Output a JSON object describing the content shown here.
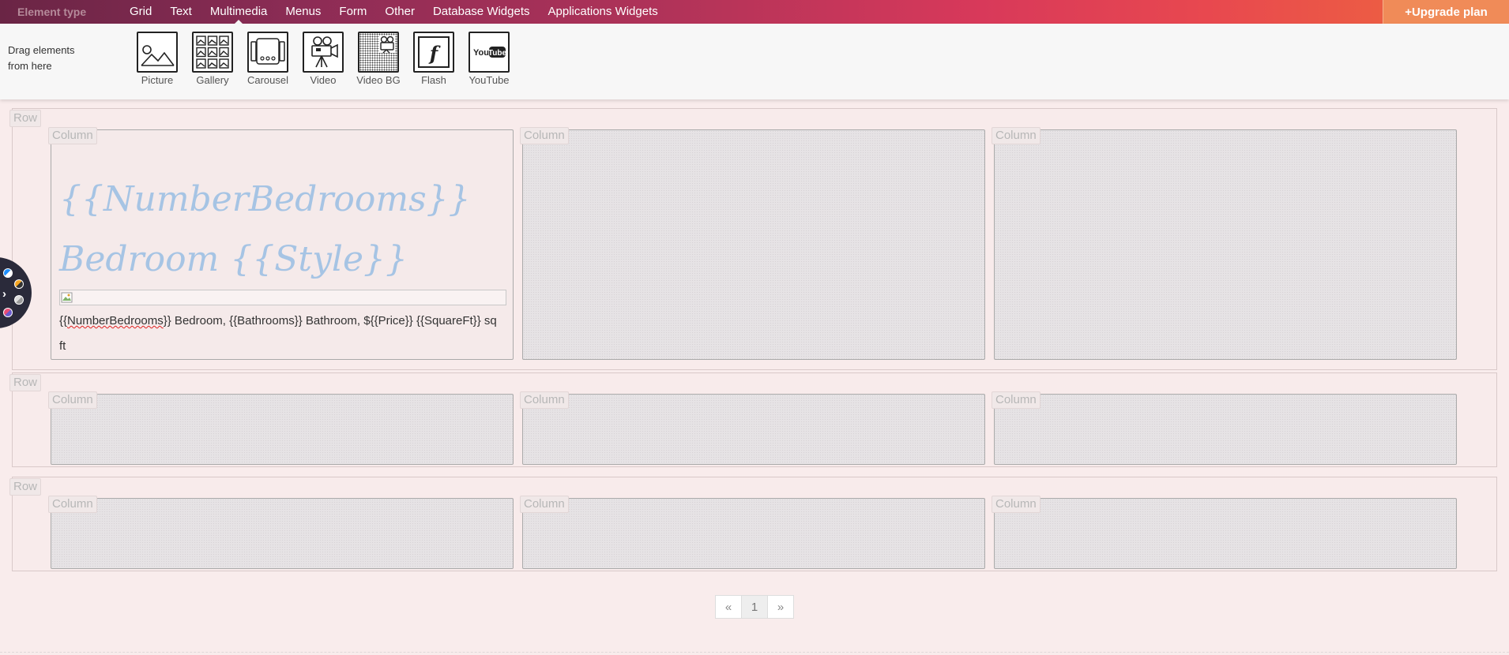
{
  "topbar": {
    "element_type": "Element type",
    "menu": [
      {
        "label": "Grid"
      },
      {
        "label": "Text"
      },
      {
        "label": "Multimedia"
      },
      {
        "label": "Menus"
      },
      {
        "label": "Form"
      },
      {
        "label": "Other"
      },
      {
        "label": "Database Widgets"
      },
      {
        "label": "Applications Widgets"
      }
    ],
    "active_menu": "Multimedia",
    "upgrade_label": "+Upgrade plan"
  },
  "palette": {
    "hint": "Drag elements from here",
    "items": [
      {
        "label": "Picture",
        "icon": "picture-icon"
      },
      {
        "label": "Gallery",
        "icon": "gallery-icon"
      },
      {
        "label": "Carousel",
        "icon": "carousel-icon"
      },
      {
        "label": "Video",
        "icon": "video-camera-icon"
      },
      {
        "label": "Video BG",
        "icon": "video-bg-icon"
      },
      {
        "label": "Flash",
        "icon": "flash-icon"
      },
      {
        "label": "YouTube",
        "icon": "youtube-icon"
      }
    ]
  },
  "grid": {
    "row_label": "Row",
    "column_label": "Column"
  },
  "content": {
    "title_template": "{{NumberBedrooms}} Bedroom {{Style}}",
    "desc_part_1": "{{",
    "desc_spell": "NumberBedrooms",
    "desc_part_2": "}} Bedroom, {{Bathrooms}} Bathroom, ${{Price}} {{SquareFt}} sq ft"
  },
  "pagination": {
    "prev": "«",
    "current": "1",
    "next": "»"
  },
  "colors": {
    "title_accent": "#a6c4e4",
    "upgrade_bg": "#f08b58",
    "topbar_start": "#6a2545",
    "topbar_end": "#ef6a3c"
  }
}
